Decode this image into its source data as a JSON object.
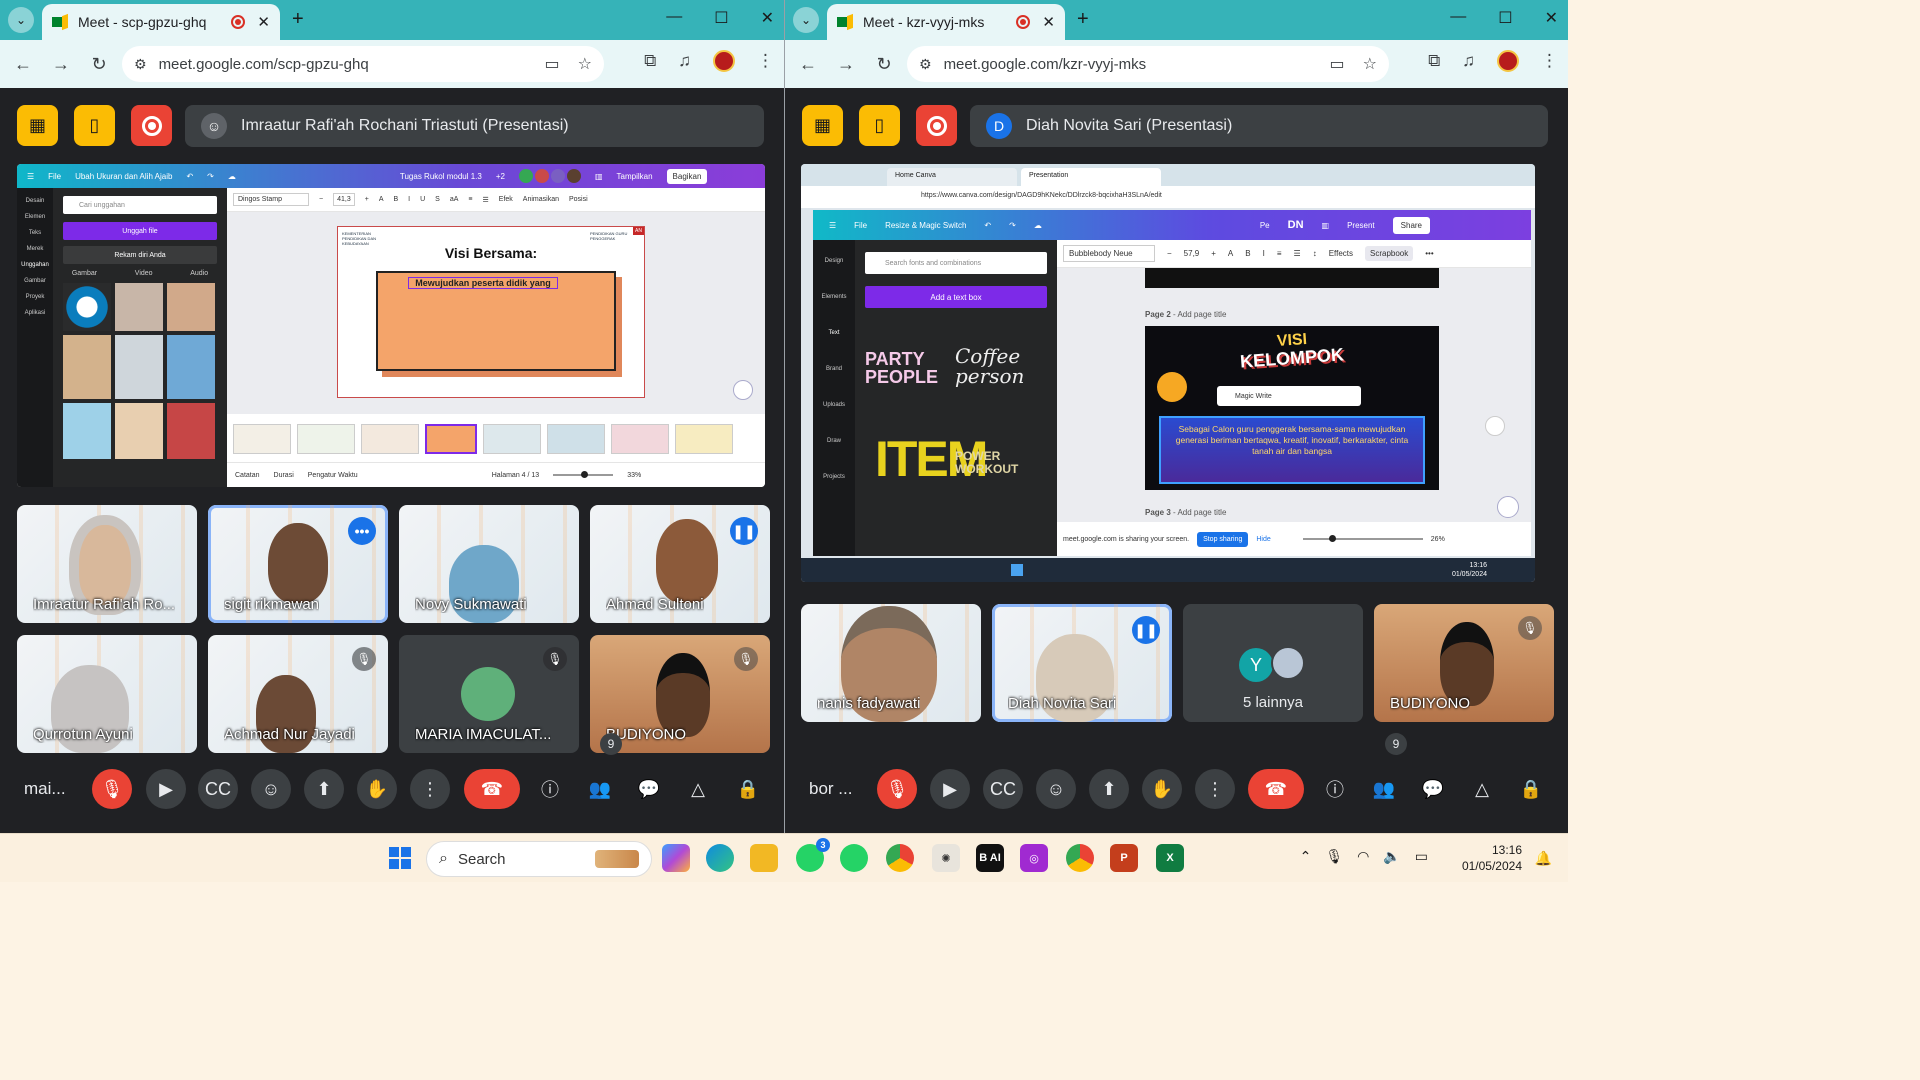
{
  "left_window": {
    "tab_title": "Meet - scp-gpzu-ghq",
    "url": "meet.google.com/scp-gpzu-ghq",
    "presenter": "Imraatur Rafi'ah Rochani Triastuti (Presentasi)",
    "meeting_code": "mai...",
    "people_count": "9",
    "canva": {
      "menu_file": "File",
      "menu_resize": "Ubah Ukuran dan Alih Ajaib",
      "doc_title": "Tugas Rukol modul 1.3",
      "collab_count": "+2",
      "btn_show": "Tampilkan",
      "btn_share": "Bagikan",
      "font_name": "Dingos Stamp",
      "font_size": "41,3",
      "effects": "Efek",
      "animate": "Animasikan",
      "position": "Posisi",
      "search_placeholder": "Cari unggahan",
      "upload_btn": "Unggah file",
      "record_btn": "Rekam diri Anda",
      "media_tabs": [
        "Gambar",
        "Video",
        "Audio"
      ],
      "side_items": [
        "Desain",
        "Elemen",
        "Teks",
        "Merek",
        "Unggahan",
        "Gambar",
        "Proyek",
        "Aplikasi"
      ],
      "slide_title": "Visi Bersama:",
      "slide_text": "Mewujudkan peserta didik yang",
      "logo_left": "KEMENTERIAN PENDIDIKAN DAN KEBUDAYAAN",
      "logo_right": "PENDIDIKAN GURU PENGGERAK",
      "badge_an": "AN",
      "footer_notes": "Catatan",
      "footer_duration": "Durasi",
      "footer_timer": "Pengatur Waktu",
      "page_label": "Halaman 4 / 13",
      "zoom": "33%"
    },
    "tiles": [
      {
        "name": "Imraatur Rafi'ah Ro..."
      },
      {
        "name": "sigit rikmawan"
      },
      {
        "name": "Novy Sukmawati"
      },
      {
        "name": "Ahmad Sultoni"
      },
      {
        "name": "Qurrotun Ayuni"
      },
      {
        "name": "Achmad Nur Jayadi"
      },
      {
        "name": "MARIA IMACULAT..."
      },
      {
        "name": "BUDIYONO"
      }
    ]
  },
  "right_window": {
    "tab_title": "Meet - kzr-vyyj-mks",
    "url": "meet.google.com/kzr-vyyj-mks",
    "presenter": "Diah Novita Sari (Presentasi)",
    "presenter_initial": "D",
    "meeting_code": "bor ...",
    "people_count": "9",
    "inner_browser": {
      "tab1": "Home  Canva",
      "tab2": "Presentation",
      "url": "https://www.canva.com/design/DAGD9hKNekc/DDlrzck8-bqcixhaH3SLnA/edit"
    },
    "canva": {
      "menu_file": "File",
      "menu_resize": "Resize & Magic Switch",
      "collab": "Pe",
      "user_initials": "DN",
      "btn_present": "Present",
      "btn_share": "Share",
      "font_name": "Bubblebody Neue",
      "font_size": "57,9",
      "effects": "Effects",
      "scrapbook": "Scrapbook",
      "search_placeholder": "Search fonts and combinations",
      "add_text_btn": "Add a text box",
      "side_items": [
        "Design",
        "Elements",
        "Text",
        "Brand",
        "Uploads",
        "Draw",
        "Projects"
      ],
      "font_samples": [
        "PARTY PEOPLE",
        "Coffee person",
        "ITEM",
        "POWER WORKOUT"
      ],
      "page2_label": "Page 2",
      "page3_label": "Page 3",
      "add_page_title": "Add page title",
      "slide_heading1": "VISI",
      "slide_heading2": "KELOMPOK",
      "magic_write": "Magic Write",
      "slide_body": "Sebagai Calon guru penggerak bersama-sama mewujudkan generasi beriman bertaqwa, kreatif, inovatif, berkarakter, cinta tanah air dan bangsa",
      "sharing_msg": "meet.google.com is sharing your screen.",
      "stop_sharing": "Stop sharing",
      "hide": "Hide",
      "zoom": "26%",
      "inner_time": "13:16",
      "inner_date": "01/05/2024"
    },
    "tiles": [
      {
        "name": "nanis fadyawati"
      },
      {
        "name": "Diah Novita Sari"
      },
      {
        "name": "5 lainnya",
        "initial": "Y"
      },
      {
        "name": "BUDIYONO"
      }
    ]
  },
  "taskbar": {
    "search_label": "Search",
    "time": "13:16",
    "date": "01/05/2024",
    "whatsapp_badge": "3"
  }
}
